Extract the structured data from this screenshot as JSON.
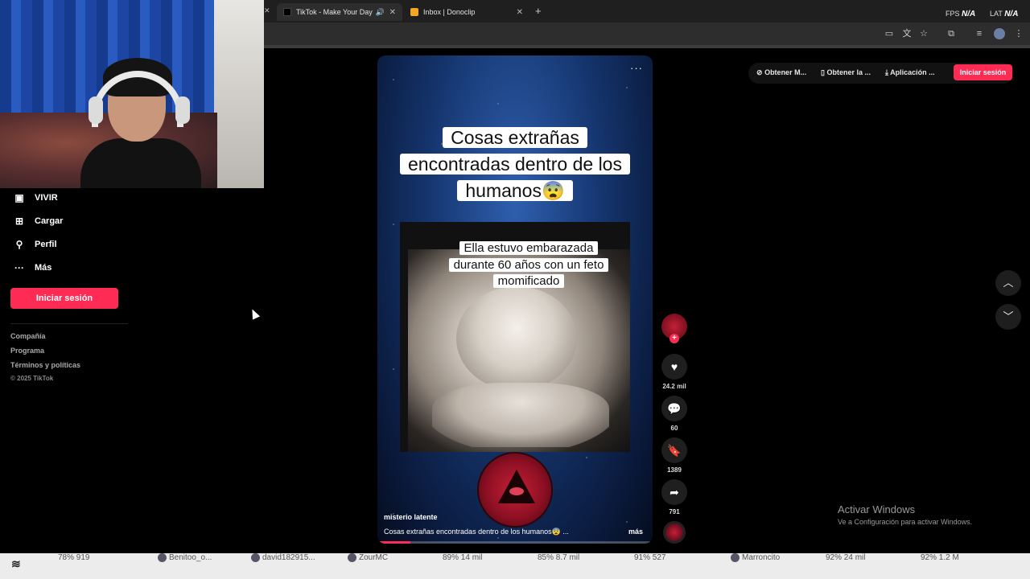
{
  "browser": {
    "tabs": [
      {
        "title": "TikTok - Make Your Day",
        "active": true
      },
      {
        "title": "Inbox | Donoclip",
        "active": false
      }
    ],
    "fps_label": "FPS",
    "fps_value": "N/A",
    "lat_label": "LAT",
    "lat_value": "N/A"
  },
  "sidebar": {
    "items": [
      {
        "label": "VIVIR",
        "icon": "live-icon"
      },
      {
        "label": "Cargar",
        "icon": "upload-icon"
      },
      {
        "label": "Perfil",
        "icon": "profile-icon"
      },
      {
        "label": "Más",
        "icon": "more-icon"
      }
    ],
    "login_label": "Iniciar sesión",
    "links": [
      "Compañía",
      "Programa",
      "Términos y políticas"
    ],
    "copyright": "© 2025 TikTok"
  },
  "video": {
    "title_lines": [
      "Cosas extrañas",
      "encontradas dentro de los",
      "humanos😨"
    ],
    "subtitle_lines": [
      "Ella estuvo embarazada",
      "durante 60 años con un feto",
      "momificado"
    ],
    "author": "misterio latente",
    "caption": "Cosas extrañas encontradas dentro de los humanos😨 ...",
    "more_label": "más",
    "progress": 0.12
  },
  "actions": {
    "likes": "24.2 mil",
    "comments": "60",
    "saves": "1389",
    "shares": "791"
  },
  "topbar": {
    "links": [
      "Obtener M...",
      "Obtener la ...",
      "Aplicación ..."
    ],
    "login_label": "Iniciar sesión"
  },
  "watermark": {
    "line1": "Activar Windows",
    "line2": "Ve a Configuración para activar Windows."
  },
  "streambar": {
    "items": [
      "78%  919",
      "Benitoo_o...",
      "david182915...",
      "ZourMC",
      "89%  14 mil",
      "85%  8.7 mil",
      "91%  527",
      "Marroncito",
      "92%  24 mil",
      "92%  1.2 M"
    ]
  }
}
